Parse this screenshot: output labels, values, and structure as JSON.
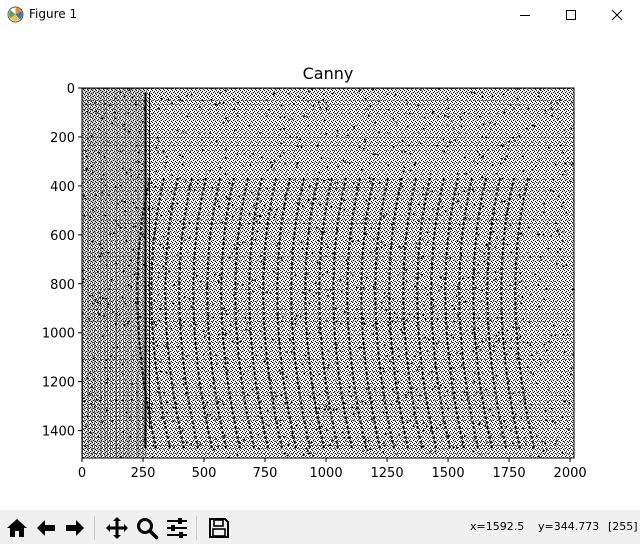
{
  "window": {
    "title": "Figure 1",
    "icon": "matplotlib-icon",
    "controls": [
      "minimize-icon",
      "maximize-icon",
      "close-icon"
    ]
  },
  "chart_data": {
    "type": "heatmap",
    "title": "Canny",
    "colormap": "gray",
    "description_colors": {
      "edge": "#000000",
      "background": "#ffffff"
    },
    "x_ticks": [
      "0",
      "250",
      "500",
      "750",
      "1000",
      "1250",
      "1500",
      "1750",
      "2000"
    ],
    "y_ticks": [
      "0",
      "200",
      "400",
      "600",
      "800",
      "1000",
      "1200",
      "1400"
    ],
    "xlim": [
      0,
      2016
    ],
    "ylim": [
      1512,
      0
    ],
    "y_inverted": true
  },
  "toolbar": {
    "buttons": [
      {
        "name": "home-button",
        "icon": "home-icon"
      },
      {
        "name": "back-button",
        "icon": "back-arrow-icon"
      },
      {
        "name": "forward-button",
        "icon": "forward-arrow-icon"
      },
      {
        "name": "pan-button",
        "icon": "move-icon"
      },
      {
        "name": "zoom-button",
        "icon": "magnifier-icon"
      },
      {
        "name": "configure-button",
        "icon": "sliders-icon"
      },
      {
        "name": "save-button",
        "icon": "floppy-disk-icon"
      }
    ],
    "status_x": "x=1592.5",
    "status_y": "y=344.773",
    "status_value": "[255]"
  }
}
